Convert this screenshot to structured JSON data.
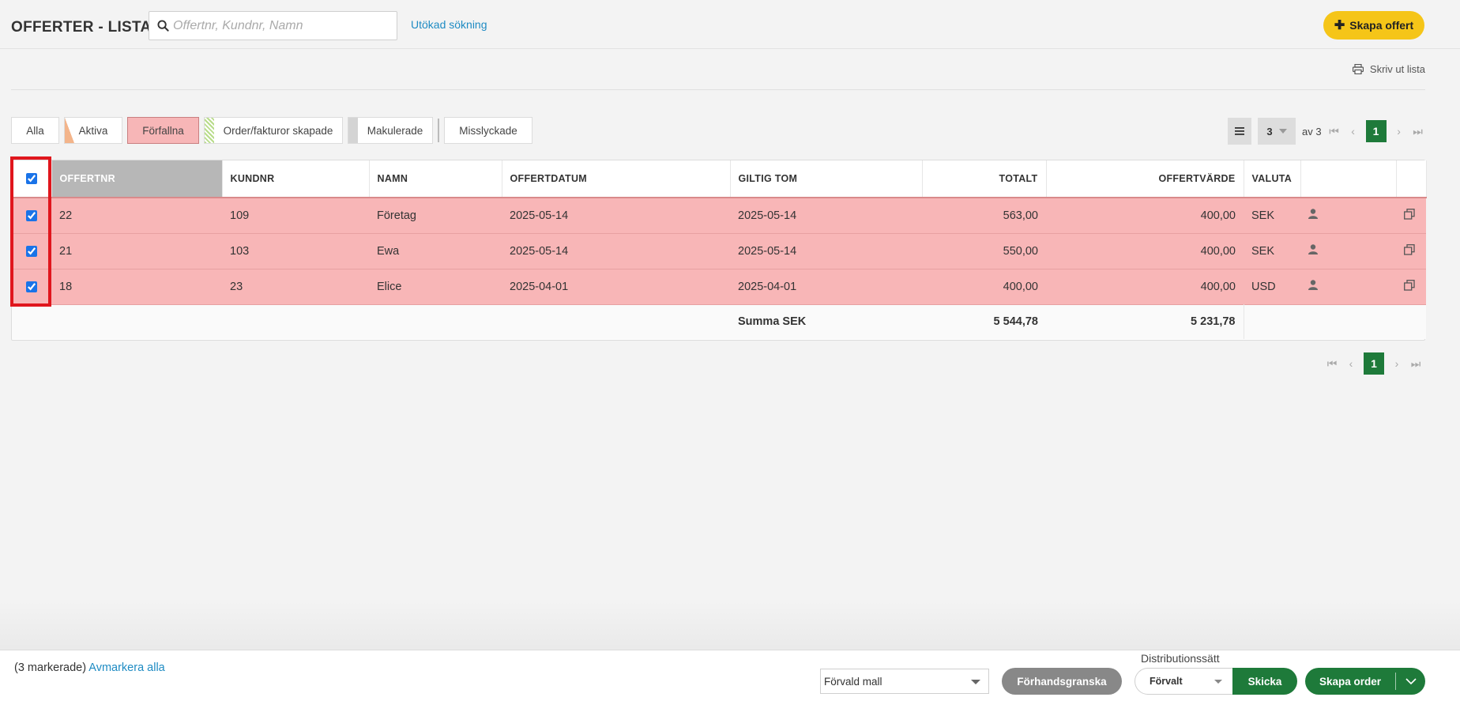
{
  "header": {
    "title": "OFFERTER - LISTA",
    "search_placeholder": "Offertnr, Kundnr, Namn",
    "search_value": "",
    "advanced_search": "Utökad sökning",
    "create_button": "Skapa offert"
  },
  "toolbar": {
    "print_list": "Skriv ut lista"
  },
  "filters": [
    {
      "label": "Alla",
      "active": false,
      "stripe": ""
    },
    {
      "label": "Aktiva",
      "active": false,
      "stripe": "#f3b48a"
    },
    {
      "label": "Förfallna",
      "active": true,
      "stripe": ""
    },
    {
      "label": "Order/fakturor skapade",
      "active": false,
      "stripe": "#b8dc8a"
    },
    {
      "label": "Makulerade",
      "active": false,
      "stripe": "#d4d4d4"
    },
    {
      "label": "Misslyckade",
      "active": false,
      "stripe": ""
    }
  ],
  "pagination": {
    "per_page": "3",
    "of_text": "av 3",
    "current_page": "1"
  },
  "table": {
    "columns": [
      "OFFERTNR",
      "KUNDNR",
      "NAMN",
      "OFFERTDATUM",
      "GILTIG TOM",
      "TOTALT",
      "OFFERTVÄRDE",
      "VALUTA"
    ],
    "rows": [
      {
        "offertnr": "22",
        "kundnr": "109",
        "namn": "Företag",
        "offertdatum": "2025-05-14",
        "giltig_tom": "2025-05-14",
        "totalt": "563,00",
        "offertvarde": "400,00",
        "valuta": "SEK"
      },
      {
        "offertnr": "21",
        "kundnr": "103",
        "namn": "Ewa",
        "offertdatum": "2025-05-14",
        "giltig_tom": "2025-05-14",
        "totalt": "550,00",
        "offertvarde": "400,00",
        "valuta": "SEK"
      },
      {
        "offertnr": "18",
        "kundnr": "23",
        "namn": "Elice",
        "offertdatum": "2025-04-01",
        "giltig_tom": "2025-04-01",
        "totalt": "400,00",
        "offertvarde": "400,00",
        "valuta": "USD"
      }
    ],
    "summary": {
      "label": "Summa SEK",
      "totalt": "5 544,78",
      "offertvarde": "5 231,78"
    }
  },
  "footer": {
    "marked_count": "(3 markerade)",
    "deselect_all": "Avmarkera alla",
    "template_value": "Förvald mall",
    "preview_button": "Förhandsgranska",
    "distribution_label": "Distributionssätt",
    "distribution_value": "Förvalt",
    "send_button": "Skicka",
    "create_order_button": "Skapa order"
  },
  "colors": {
    "brand_green": "#1e7a3a",
    "accent_yellow": "#f5c518",
    "overdue_row": "#f8b6b7",
    "highlight_red": "#e0161d"
  }
}
